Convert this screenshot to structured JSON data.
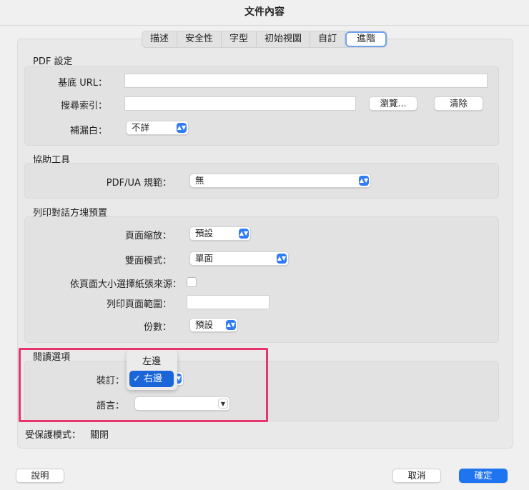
{
  "window": {
    "title": "文件內容"
  },
  "tabs": [
    "描述",
    "安全性",
    "字型",
    "初始視圖",
    "自訂",
    "進階"
  ],
  "pdf_settings": {
    "heading": "PDF 設定",
    "base_url_label": "基底 URL：",
    "base_url_value": "",
    "search_index_label": "搜尋索引：",
    "search_index_value": "",
    "browse_button": "瀏覽...",
    "clear_button": "清除",
    "trapped_label": "補漏白：",
    "trapped_value": "不詳"
  },
  "accessibility": {
    "heading": "協助工具",
    "pdfua_label": "PDF/UA 規範：",
    "pdfua_value": "無"
  },
  "print_presets": {
    "heading": "列印對話方塊預置",
    "scaling_label": "頁面縮放：",
    "scaling_value": "預設",
    "duplex_label": "雙面模式：",
    "duplex_value": "單面",
    "paper_source_label": "依頁面大小選擇紙張來源：",
    "paper_source_checked": false,
    "page_range_label": "列印頁面範圍：",
    "page_range_value": "",
    "copies_label": "份數：",
    "copies_value": "預設"
  },
  "reading_options": {
    "heading": "閱讀選項",
    "binding_label": "裝訂：",
    "binding_menu": [
      "左邊",
      "右邊"
    ],
    "binding_selected": "右邊",
    "check_mark": "✓",
    "language_label": "語言：",
    "language_value": ""
  },
  "protected_mode": {
    "label": "受保護模式：",
    "value": "關閉"
  },
  "footer": {
    "help_button": "說明",
    "cancel_button": "取消",
    "ok_button": "確定"
  }
}
